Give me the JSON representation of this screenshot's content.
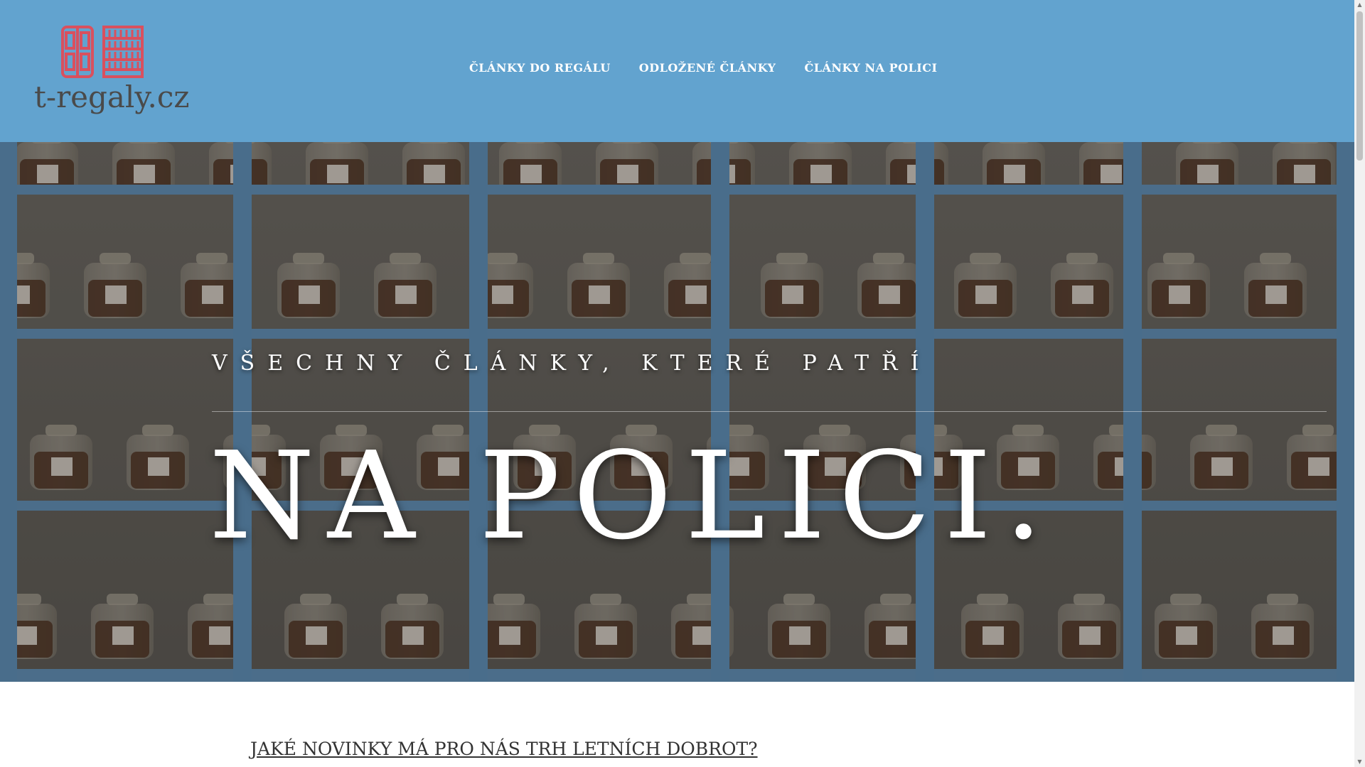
{
  "site": {
    "logo_text": "t-regaly.cz",
    "logo_icon": "tea-cabinet-logo-icon",
    "brand_color": "#62a3cf",
    "logo_color": "#d9505e"
  },
  "nav": {
    "items": [
      {
        "label": "ČLÁNKY DO REGÁLU"
      },
      {
        "label": "ODLOŽENÉ ČLÁNKY"
      },
      {
        "label": "ČLÁNKY NA POLICI"
      }
    ]
  },
  "hero": {
    "subtitle": "VŠECHNY ČLÁNKY, KTERÉ PATŘÍ",
    "title": "NA POLICI.",
    "background": "tea-jars-shelf-photo"
  },
  "article": {
    "title": "JAKÉ NOVINKY MÁ PRO NÁS TRH LETNÍCH DOBROT?"
  },
  "scrollbar": {
    "up_icon": "▲",
    "down_icon": "▼"
  }
}
